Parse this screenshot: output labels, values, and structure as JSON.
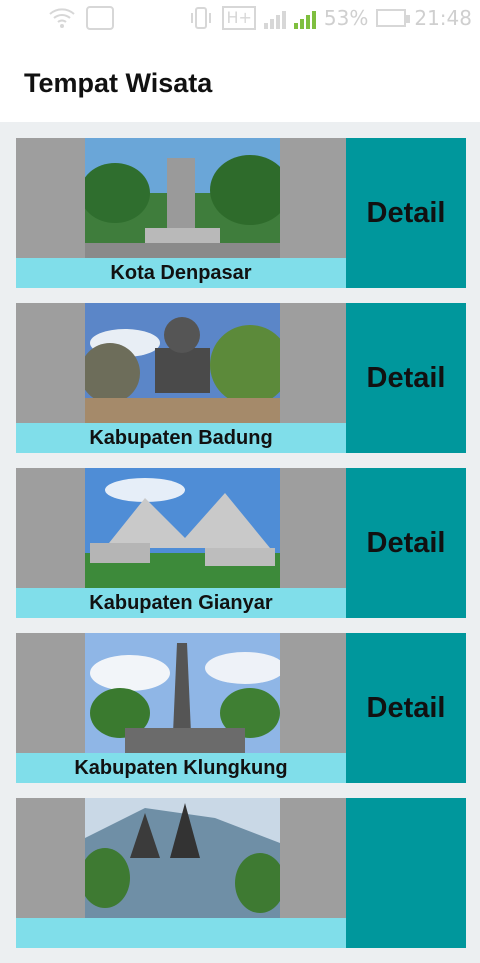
{
  "status_bar": {
    "icons": [
      "wifi-icon",
      "image-icon",
      "vibrate-icon",
      "h-plus-icon",
      "signal-1-icon",
      "signal-2-icon",
      "battery-icon"
    ],
    "network": "H+",
    "sim1": "1",
    "sim2": "2",
    "battery": "53%",
    "time": "21:48"
  },
  "app_bar": {
    "title": "Tempat Wisata"
  },
  "colors": {
    "accent": "#00979c",
    "caption_bg": "#80deea",
    "thumb_bg": "#9e9e9e",
    "page_bg": "#eceff1"
  },
  "items": [
    {
      "name": "Kota Denpasar",
      "button": "Detail"
    },
    {
      "name": "Kabupaten Badung",
      "button": "Detail"
    },
    {
      "name": "Kabupaten Gianyar",
      "button": "Detail"
    },
    {
      "name": "Kabupaten Klungkung",
      "button": "Detail"
    },
    {
      "name": "",
      "button": ""
    }
  ]
}
